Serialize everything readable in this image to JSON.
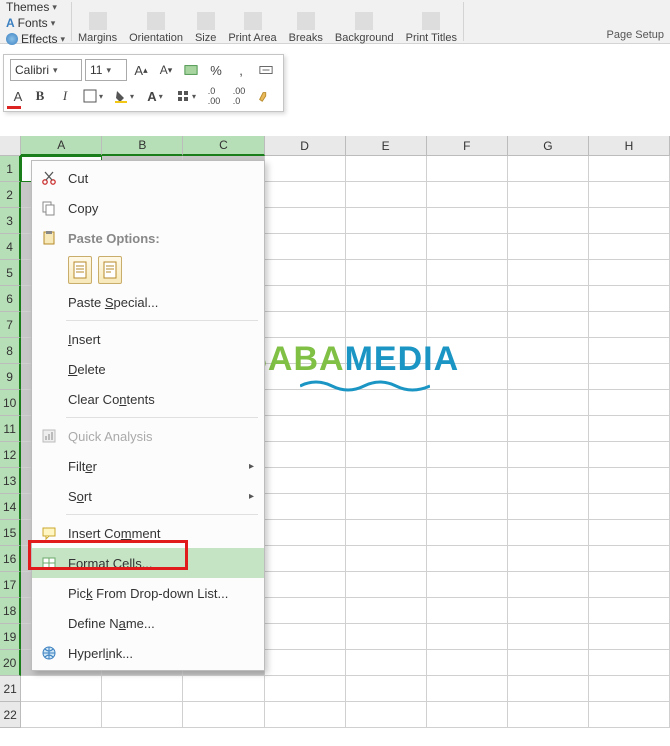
{
  "ribbon": {
    "themes_label": "Themes",
    "fonts_label": "Fonts",
    "effects_label": "Effects",
    "margins_label": "Margins",
    "orientation_label": "Orientation",
    "size_label": "Size",
    "print_area_label": "Print Area",
    "breaks_label": "Breaks",
    "background_label": "Background",
    "print_titles_label": "Print Titles",
    "page_setup_caption": "Page Setup"
  },
  "mini": {
    "font_name": "Calibri",
    "font_size": "11",
    "bold": "B",
    "italic": "I",
    "percent": "%",
    "comma": ","
  },
  "columns": [
    "A",
    "B",
    "C",
    "D",
    "E",
    "F",
    "G",
    "H"
  ],
  "rows": [
    "1",
    "2",
    "3",
    "4",
    "5",
    "6",
    "7",
    "8",
    "9",
    "10",
    "11",
    "12",
    "13",
    "14",
    "15",
    "16",
    "17",
    "18",
    "19",
    "20",
    "21",
    "22"
  ],
  "selected_cols": [
    "A",
    "B",
    "C"
  ],
  "unsel_last_rows": [
    "21",
    "22"
  ],
  "active_cell": {
    "row": "1",
    "col": "A"
  },
  "ctx": {
    "cut": "Cut",
    "copy": "Copy",
    "paste_options": "Paste Options:",
    "paste_special": "Paste Special...",
    "insert": "Insert",
    "delete": "Delete",
    "clear_contents": "Clear Contents",
    "quick_analysis": "Quick Analysis",
    "filter": "Filter",
    "sort": "Sort",
    "insert_comment": "Insert Comment",
    "format_cells": "Format Cells...",
    "pick_from_list": "Pick From Drop-down List...",
    "define_name": "Define Name...",
    "hyperlink": "Hyperlink..."
  },
  "watermark": {
    "p1": "NESABA",
    "p2": "MEDIA"
  }
}
